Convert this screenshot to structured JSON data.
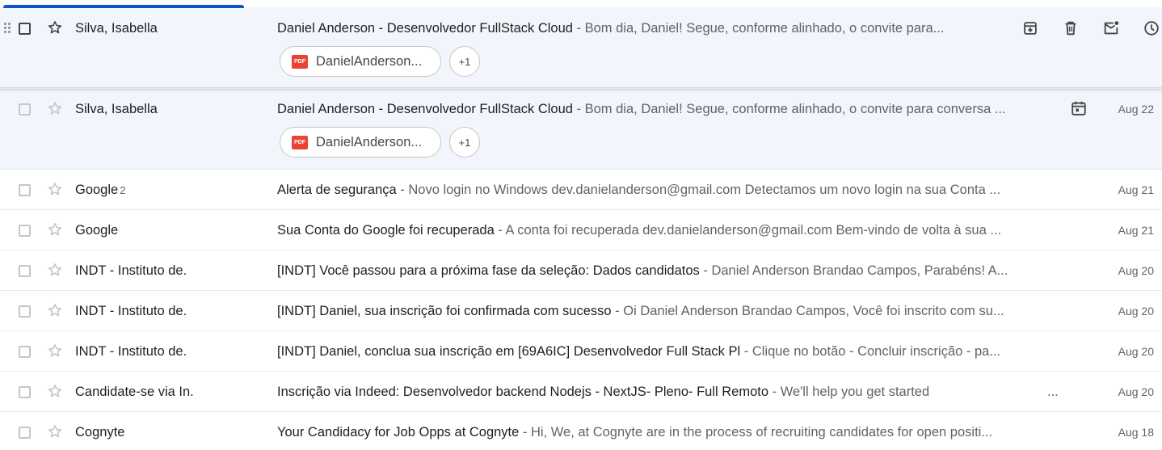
{
  "emails": [
    {
      "sender": "Silva, Isabella",
      "count": "",
      "subject": "Daniel Anderson - Desenvolvedor FullStack Cloud",
      "snippet": " - Bom dia, Daniel! Segue, conforme alinhado, o convite para...",
      "date": "",
      "attachment": "DanielAnderson...",
      "more_attachments": "+1",
      "state": "hover"
    },
    {
      "sender": "Silva, Isabella",
      "count": "",
      "subject": "Daniel Anderson - Desenvolvedor FullStack Cloud",
      "snippet": " - Bom dia, Daniel! Segue, conforme alinhado, o convite para conversa ...",
      "date": "Aug 22",
      "attachment": "DanielAnderson...",
      "more_attachments": "+1",
      "state": "calendar"
    },
    {
      "sender": "Google",
      "count": "2",
      "subject": "Alerta de segurança",
      "snippet": " - Novo login no Windows dev.danielanderson@gmail.com Detectamos um novo login na sua Conta ...",
      "date": "Aug 21"
    },
    {
      "sender": "Google",
      "count": "",
      "subject": "Sua Conta do Google foi recuperada",
      "snippet": " - A conta foi recuperada dev.danielanderson@gmail.com Bem-vindo de volta à sua ...",
      "date": "Aug 21"
    },
    {
      "sender": "INDT - Instituto de.",
      "count": "",
      "subject": "[INDT] Você passou para a próxima fase da seleção: Dados candidatos",
      "snippet": " - Daniel Anderson Brandao Campos, Parabéns! A...",
      "date": "Aug 20"
    },
    {
      "sender": "INDT - Instituto de.",
      "count": "",
      "subject": "[INDT] Daniel, sua inscrição foi confirmada com sucesso",
      "snippet": " - Oi Daniel Anderson Brandao Campos, Você foi inscrito com su...",
      "date": "Aug 20"
    },
    {
      "sender": "INDT - Instituto de.",
      "count": "",
      "subject": "[INDT] Daniel, conclua sua inscrição em [69A6IC] Desenvolvedor Full Stack Pl",
      "snippet": " - Clique no botão - Concluir inscrição - pa...",
      "date": "Aug 20"
    },
    {
      "sender": "Candidate-se via In.",
      "count": "",
      "subject": "Inscrição via Indeed: Desenvolvedor backend Nodejs - NextJS- Pleno- Full Remoto",
      "snippet": " - We'll help you get started",
      "snippet_tail": "...",
      "date": "Aug 20"
    },
    {
      "sender": "Cognyte",
      "count": "",
      "subject": "Your Candidacy for Job Opps at Cognyte",
      "snippet": " - Hi, We, at Cognyte are in the process of recruiting candidates for open positi...",
      "date": "Aug 18"
    }
  ],
  "hover_actions": [
    "archive-icon",
    "delete-icon",
    "mark-unread-icon",
    "snooze-icon"
  ],
  "colors": {
    "accent": "#0b57d0",
    "hover_bg": "#f2f6fc",
    "pdf_red": "#ea4335"
  }
}
